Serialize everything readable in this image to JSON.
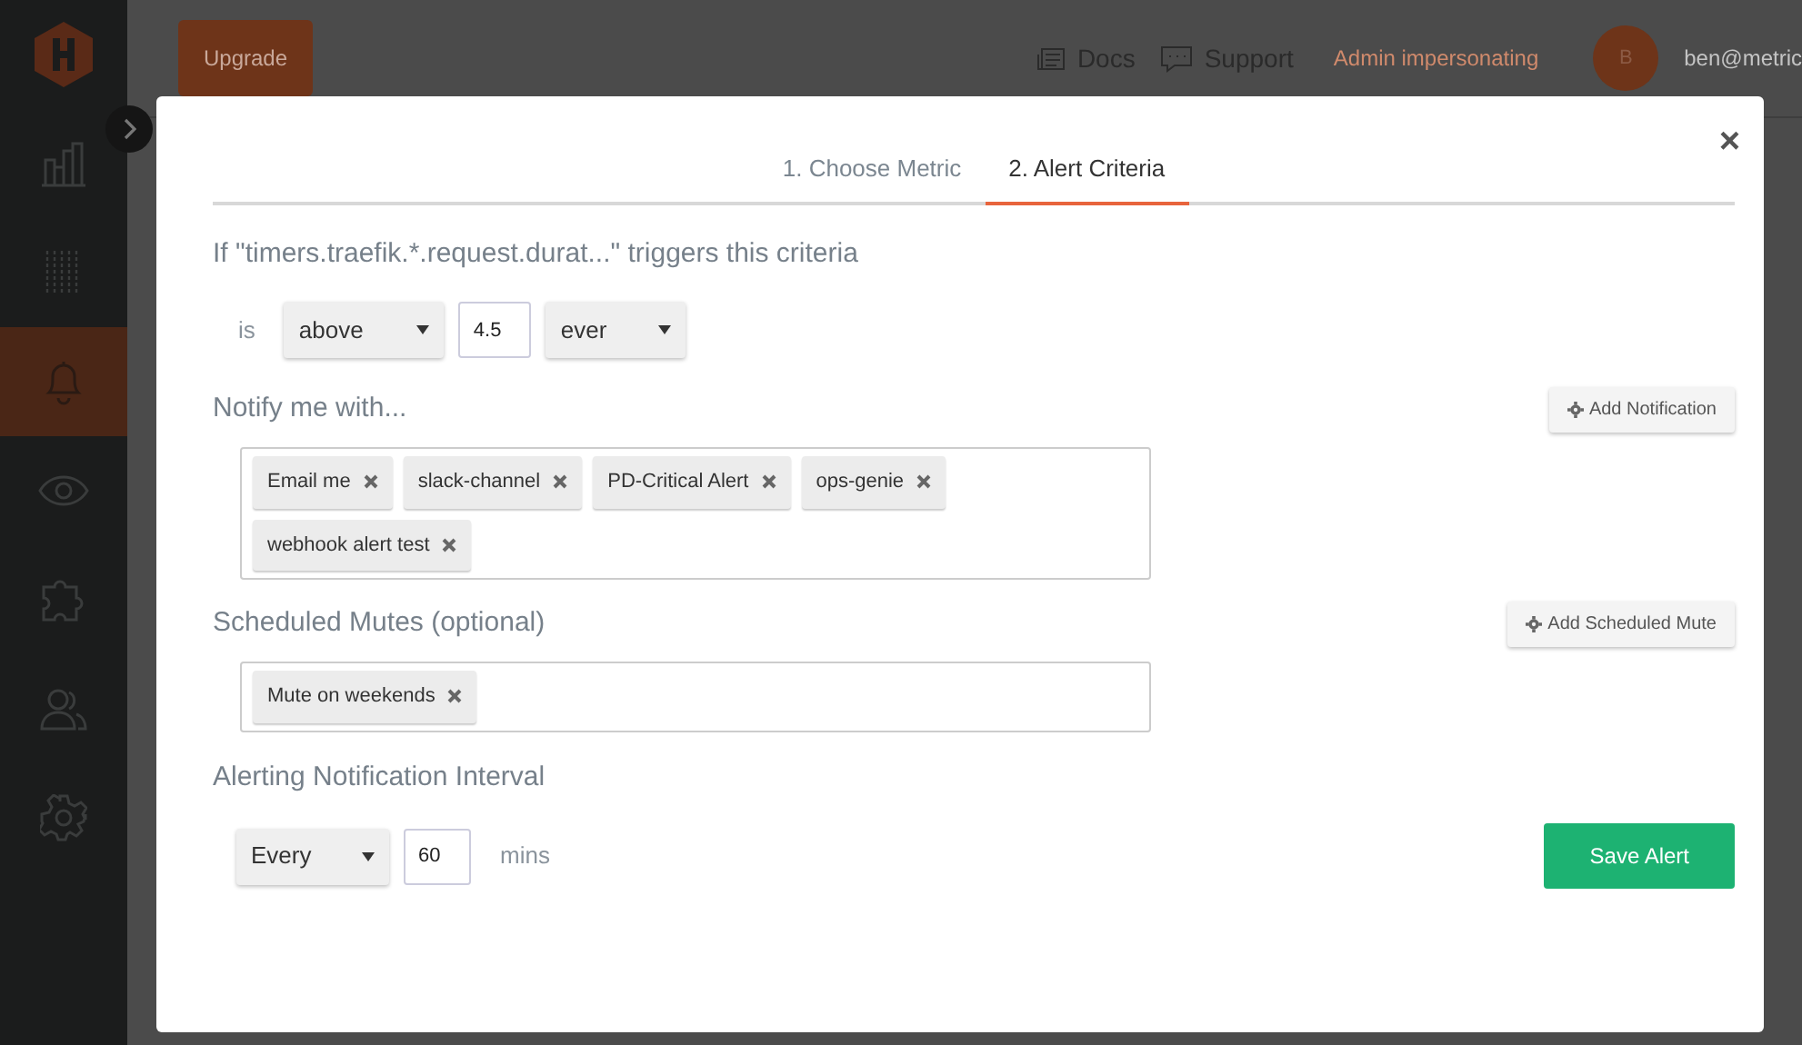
{
  "header": {
    "upgrade": "Upgrade",
    "links": [
      {
        "kind": "docs",
        "label": "Docs"
      },
      {
        "kind": "support",
        "label": "Support"
      }
    ],
    "admin": "Admin impersonating",
    "avatar": "B",
    "user": "ben@metric"
  },
  "sidebar": {
    "items": [
      {
        "kind": "chart",
        "selected": false
      },
      {
        "kind": "sliders",
        "selected": false
      },
      {
        "kind": "bell",
        "selected": true
      },
      {
        "kind": "eye",
        "selected": false
      },
      {
        "kind": "puzzle",
        "selected": false
      },
      {
        "kind": "users",
        "selected": false
      },
      {
        "kind": "gear",
        "selected": false
      }
    ]
  },
  "modal": {
    "close": "×",
    "tabs": [
      {
        "label": "1. Choose Metric",
        "selected": false
      },
      {
        "label": "2. Alert Criteria",
        "selected": true
      }
    ],
    "criteria": {
      "title": "If \"timers.traefik.*.request.durat...\" triggers this criteria",
      "prefix": "is",
      "comparator": "above",
      "threshold": "4.5",
      "duration": "ever"
    },
    "notify": {
      "title": "Notify me with...",
      "button": "Add Notification",
      "tags": [
        "Email me",
        "slack-channel",
        "PD-Critical Alert",
        "ops-genie",
        "webhook alert test"
      ]
    },
    "mutes": {
      "title": "Scheduled Mutes (optional)",
      "button": "Add Scheduled Mute",
      "tags": [
        "Mute on weekends"
      ]
    },
    "interval": {
      "title": "Alerting Notification Interval",
      "frequency": "Every",
      "minutes": "60",
      "unit": "mins"
    },
    "save": "Save Alert"
  }
}
